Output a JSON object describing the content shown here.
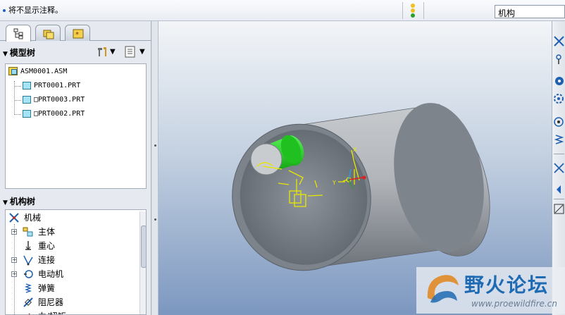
{
  "statusbar": {
    "message": "将不显示注释。",
    "filter_value": "机构"
  },
  "left_panel": {
    "tabs": [
      {
        "icon": "model-tree-tab-icon",
        "active": true
      },
      {
        "icon": "folder-browser-tab-icon",
        "active": false
      },
      {
        "icon": "favorites-tab-icon",
        "active": false
      }
    ],
    "model_tree": {
      "title": "模型树",
      "items": [
        {
          "label": "ASM0001.ASM",
          "icon": "assembly-icon"
        },
        {
          "label": "PRT0001.PRT",
          "icon": "part-icon"
        },
        {
          "label": "□PRT0003.PRT",
          "icon": "part-icon"
        },
        {
          "label": "□PRT0002.PRT",
          "icon": "part-icon"
        }
      ]
    },
    "mechanism_tree": {
      "title": "机构树",
      "items": [
        {
          "label": "机械",
          "icon": "mechanism-icon",
          "expandable": false
        },
        {
          "label": "主体",
          "icon": "body-icon",
          "expandable": true
        },
        {
          "label": "重心",
          "icon": "gravity-icon",
          "expandable": false
        },
        {
          "label": "连接",
          "icon": "connection-icon",
          "expandable": true
        },
        {
          "label": "电动机",
          "icon": "motor-icon",
          "expandable": true
        },
        {
          "label": "弹簧",
          "icon": "spring-icon",
          "expandable": false
        },
        {
          "label": "阻尼器",
          "icon": "damper-icon",
          "expandable": false
        },
        {
          "label": "力/扭矩",
          "icon": "force-icon",
          "expandable": false
        }
      ]
    }
  },
  "viewport": {
    "labels": {
      "x_axis": "X",
      "y_axis": "Y"
    },
    "colors": {
      "cylinder": "#a9adb3",
      "pin": "#1ed31e",
      "datum": "#e8e800",
      "marker": "#e02020"
    }
  },
  "watermark": {
    "title": "野火论坛",
    "url": "www.proewildfire.cn"
  }
}
